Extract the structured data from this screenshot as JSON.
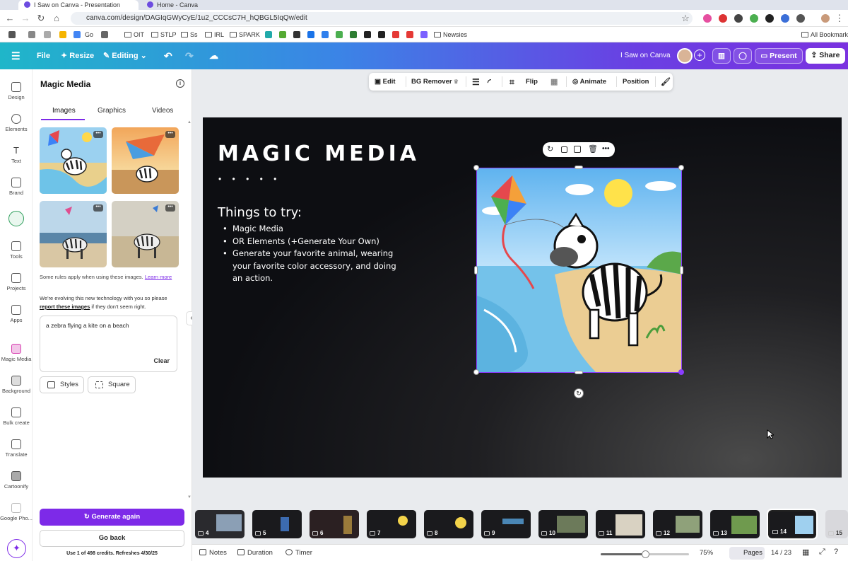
{
  "browser": {
    "tabs": [
      {
        "label": "I Saw on Canva - Presentation"
      },
      {
        "label": "Home - Canva"
      }
    ],
    "url": "canva.com/design/DAGIqGWyCyE/1u2_CCCsC7H_hQBGL5IqQw/edit",
    "bookmarks": [
      "Go",
      "OIT",
      "STLP",
      "Ss",
      "IRL",
      "SPARK",
      "Newsies"
    ],
    "all_bookmarks": "All Bookmarks"
  },
  "topbar": {
    "file": "File",
    "resize": "Resize",
    "editing": "Editing",
    "doc_title": "I Saw on Canva",
    "present": "Present",
    "share": "Share"
  },
  "rail": [
    {
      "label": "Design",
      "icon": "design-icon"
    },
    {
      "label": "Elements",
      "icon": "elements-icon"
    },
    {
      "label": "Text",
      "icon": "text-icon"
    },
    {
      "label": "Brand",
      "icon": "brand-icon"
    },
    {
      "label": "",
      "icon": "uploads-icon"
    },
    {
      "label": "Tools",
      "icon": "tools-icon"
    },
    {
      "label": "Projects",
      "icon": "projects-icon"
    },
    {
      "label": "Apps",
      "icon": "apps-icon"
    },
    {
      "label": "Magic Media",
      "icon": "magic-media-icon"
    },
    {
      "label": "Background",
      "icon": "background-icon"
    },
    {
      "label": "Bulk create",
      "icon": "bulk-create-icon"
    },
    {
      "label": "Translate",
      "icon": "translate-icon"
    },
    {
      "label": "Cartoonify",
      "icon": "cartoonify-icon"
    },
    {
      "label": "Google Pho...",
      "icon": "google-photos-icon"
    }
  ],
  "panel": {
    "title": "Magic Media",
    "tabs": [
      "Images",
      "Graphics",
      "Videos"
    ],
    "rules_text": "Some rules apply when using these images.",
    "learn_more": "Learn more",
    "evolve_text": "We're evolving this new technology with you so please",
    "report_link": "report these images",
    "evolve_tail": "if they don't seem right.",
    "prompt": "a zebra flying a kite on a beach",
    "clear": "Clear",
    "styles": "Styles",
    "square": "Square",
    "generate_again": "Generate again",
    "go_back": "Go back",
    "credits": "Use 1 of 498 credits. Refreshes 4/30/25"
  },
  "context_toolbar": {
    "edit": "Edit",
    "bg_remover": "BG Remover",
    "flip": "Flip",
    "animate": "Animate",
    "position": "Position"
  },
  "slide": {
    "title": "MAGIC MEDIA",
    "dots": "• • • • •",
    "heading": "Things to try:",
    "bullets": [
      "Magic Media",
      "OR Elements (+Generate Your Own)",
      "Generate your favorite animal, wearing your favorite color accessory, and doing an action."
    ]
  },
  "filmstrip": {
    "pages": [
      "4",
      "5",
      "6",
      "7",
      "8",
      "9",
      "10",
      "11",
      "12",
      "13",
      "14",
      "15"
    ],
    "current": "14"
  },
  "statusbar": {
    "notes": "Notes",
    "duration": "Duration",
    "timer": "Timer",
    "zoom": "75%",
    "zoom_fraction": 0.5,
    "pages": "Pages",
    "page_count": "14 / 23"
  },
  "colors": {
    "accent": "#7d2ae8",
    "slide_bg": "#0d0e12"
  }
}
